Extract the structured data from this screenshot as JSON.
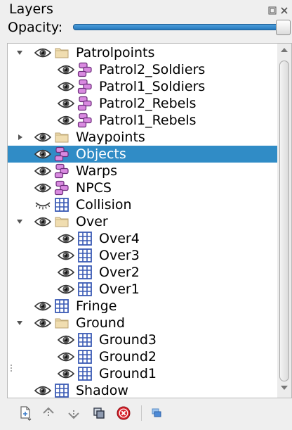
{
  "panel": {
    "title": "Layers",
    "opacity_label": "Opacity:",
    "opacity_value": 1.0,
    "float_button": "float-icon",
    "close_button": "close-icon"
  },
  "layers": [
    {
      "label": "Patrolpoints",
      "type": "group",
      "depth": 0,
      "expanded": true,
      "visible": true,
      "selected": false
    },
    {
      "label": "Patrol2_Soldiers",
      "type": "objects",
      "depth": 1,
      "expanded": null,
      "visible": true,
      "selected": false
    },
    {
      "label": "Patrol1_Soldiers",
      "type": "objects",
      "depth": 1,
      "expanded": null,
      "visible": true,
      "selected": false
    },
    {
      "label": "Patrol2_Rebels",
      "type": "objects",
      "depth": 1,
      "expanded": null,
      "visible": true,
      "selected": false
    },
    {
      "label": "Patrol1_Rebels",
      "type": "objects",
      "depth": 1,
      "expanded": null,
      "visible": true,
      "selected": false
    },
    {
      "label": "Waypoints",
      "type": "group",
      "depth": 0,
      "expanded": false,
      "visible": true,
      "selected": false
    },
    {
      "label": "Objects",
      "type": "objects",
      "depth": 0,
      "expanded": null,
      "visible": true,
      "selected": true
    },
    {
      "label": "Warps",
      "type": "objects",
      "depth": 0,
      "expanded": null,
      "visible": true,
      "selected": false
    },
    {
      "label": "NPCS",
      "type": "objects",
      "depth": 0,
      "expanded": null,
      "visible": true,
      "selected": false
    },
    {
      "label": "Collision",
      "type": "tile",
      "depth": 0,
      "expanded": null,
      "visible": false,
      "selected": false
    },
    {
      "label": "Over",
      "type": "group",
      "depth": 0,
      "expanded": true,
      "visible": true,
      "selected": false
    },
    {
      "label": "Over4",
      "type": "tile",
      "depth": 1,
      "expanded": null,
      "visible": true,
      "selected": false
    },
    {
      "label": "Over3",
      "type": "tile",
      "depth": 1,
      "expanded": null,
      "visible": true,
      "selected": false
    },
    {
      "label": "Over2",
      "type": "tile",
      "depth": 1,
      "expanded": null,
      "visible": true,
      "selected": false
    },
    {
      "label": "Over1",
      "type": "tile",
      "depth": 1,
      "expanded": null,
      "visible": true,
      "selected": false
    },
    {
      "label": "Fringe",
      "type": "tile",
      "depth": 0,
      "expanded": null,
      "visible": true,
      "selected": false
    },
    {
      "label": "Ground",
      "type": "group",
      "depth": 0,
      "expanded": true,
      "visible": true,
      "selected": false
    },
    {
      "label": "Ground3",
      "type": "tile",
      "depth": 1,
      "expanded": null,
      "visible": true,
      "selected": false
    },
    {
      "label": "Ground2",
      "type": "tile",
      "depth": 1,
      "expanded": null,
      "visible": true,
      "selected": false
    },
    {
      "label": "Ground1",
      "type": "tile",
      "depth": 1,
      "expanded": null,
      "visible": true,
      "selected": false
    },
    {
      "label": "Shadow",
      "type": "tile",
      "depth": 0,
      "expanded": null,
      "visible": true,
      "selected": false
    }
  ],
  "toolbar": [
    "new-layer-icon",
    "raise-layer-icon",
    "lower-layer-icon",
    "duplicate-layer-icon",
    "remove-layer-icon",
    "highlight-layer-icon"
  ],
  "colors": {
    "selection": "#308cc6",
    "slider_fill": "#2679bd",
    "folder": "#f0ddb0",
    "object_layer": "#d98ae0",
    "tile_layer": "#3b5bb5",
    "remove": "#d8202a"
  }
}
